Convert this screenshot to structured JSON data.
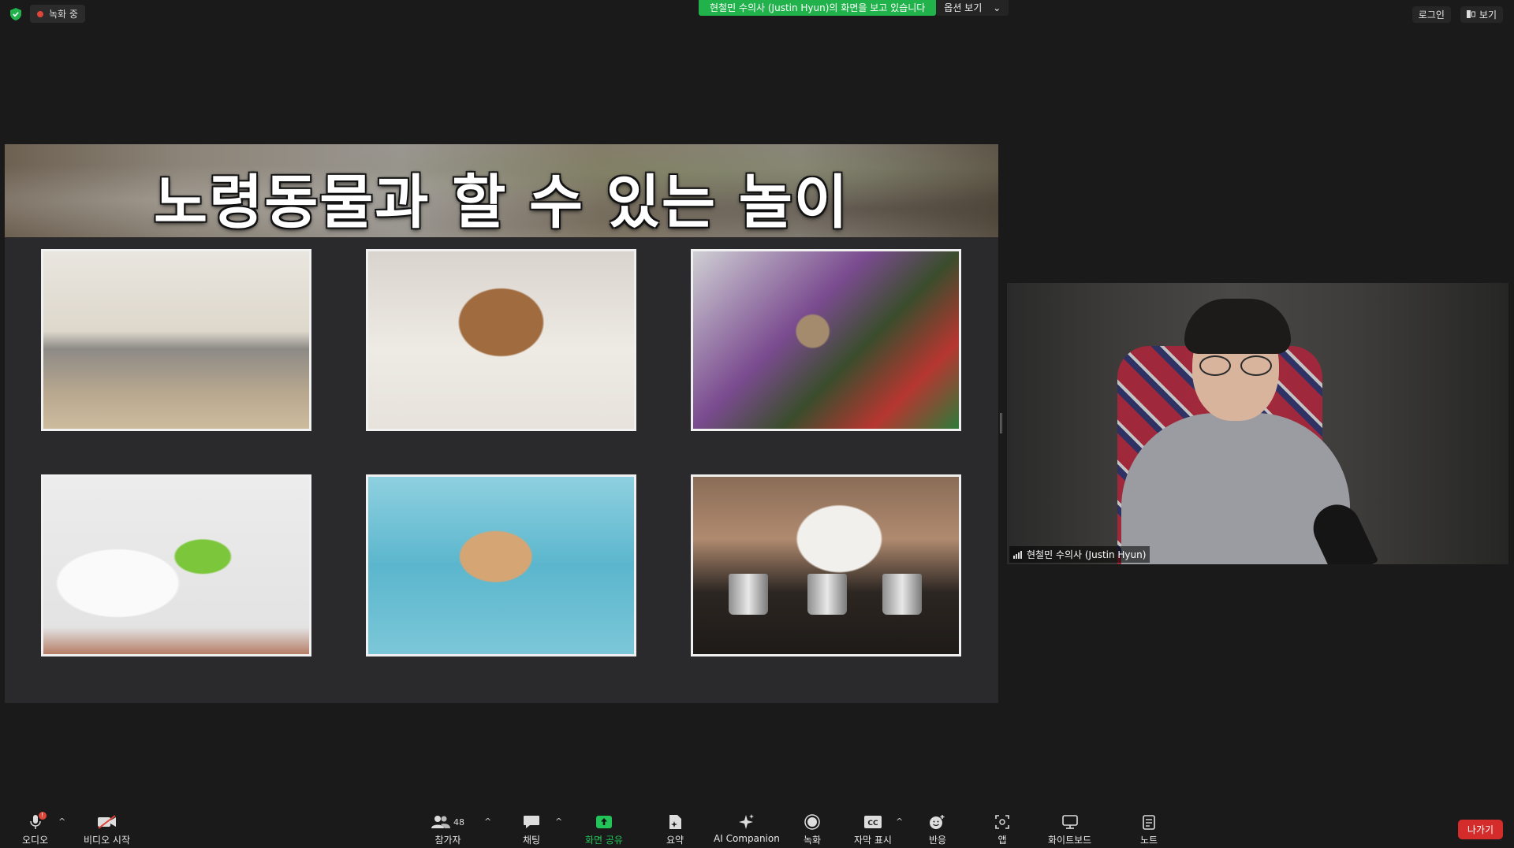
{
  "topbar": {
    "recording_label": "녹화 중",
    "share_banner": "현철민 수의사 (Justin  Hyun)의 화면을 보고 있습니다",
    "view_options": "옵션 보기",
    "login": "로그인",
    "view": "보기"
  },
  "slide": {
    "title": "노령동물과 할 수 있는 놀이"
  },
  "video": {
    "participant_name": "현철민 수의사 (Justin Hyun)"
  },
  "toolbar": {
    "audio": "오디오",
    "video_start": "비디오 시작",
    "participants": "참가자",
    "participants_count": "48",
    "chat": "채팅",
    "share_screen": "화면 공유",
    "summary": "요약",
    "ai_companion": "AI Companion",
    "record": "녹화",
    "captions": "자막 표시",
    "captions_icon_text": "CC",
    "reactions": "반응",
    "apps": "앱",
    "whiteboard": "화이트보드",
    "notes": "노트",
    "leave": "나가기"
  },
  "colors": {
    "share_green": "#22b24c",
    "recording_red": "#e0453a",
    "leave_red": "#d42b2b",
    "background": "#1a1a1a"
  }
}
